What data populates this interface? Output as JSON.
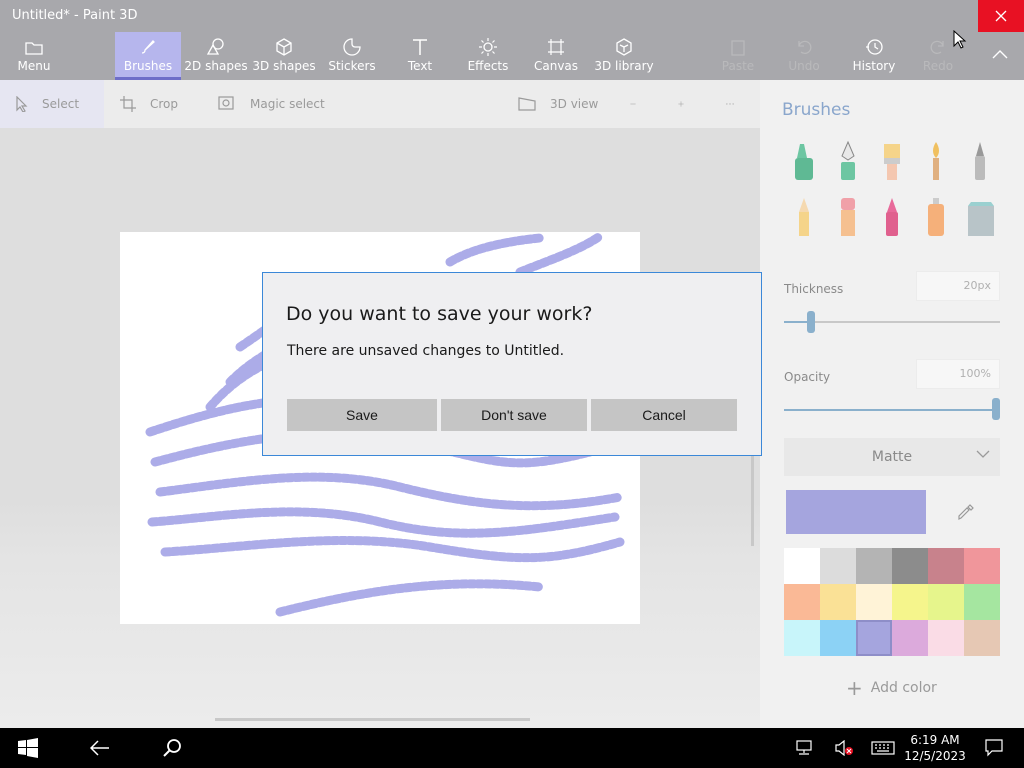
{
  "window": {
    "title": "Untitled* - Paint 3D"
  },
  "ribbon": {
    "menu": "Menu",
    "brushes": "Brushes",
    "shapes2d": "2D shapes",
    "shapes3d": "3D shapes",
    "stickers": "Stickers",
    "text": "Text",
    "effects": "Effects",
    "canvas": "Canvas",
    "library": "3D library",
    "paste": "Paste",
    "undo": "Undo",
    "history": "History",
    "redo": "Redo"
  },
  "toolbar": {
    "select": "Select",
    "crop": "Crop",
    "magic_select": "Magic select",
    "view3d": "3D view"
  },
  "panel": {
    "title": "Brushes",
    "thickness_label": "Thickness",
    "thickness_value": "20px",
    "opacity_label": "Opacity",
    "opacity_value": "100%",
    "finish": "Matte",
    "add_color": "Add color",
    "current_color": "#a5a5de",
    "swatches": [
      "#ffffff",
      "#dcdcdc",
      "#b4b4b4",
      "#8c8c8c",
      "#c8828c",
      "#f0969b",
      "#fab996",
      "#fae196",
      "#fff3d7",
      "#f5f58c",
      "#e6f58c",
      "#a5e6a0",
      "#c8f5fa",
      "#8cd2f5",
      "#a5a5de",
      "#dcaadc",
      "#fadce6",
      "#e6c8b4"
    ]
  },
  "dialog": {
    "title": "Do you want to save your work?",
    "message": "There are unsaved changes to Untitled.",
    "save": "Save",
    "dont_save": "Don't save",
    "cancel": "Cancel"
  },
  "taskbar": {
    "time": "6:19 AM",
    "date": "12/5/2023"
  }
}
